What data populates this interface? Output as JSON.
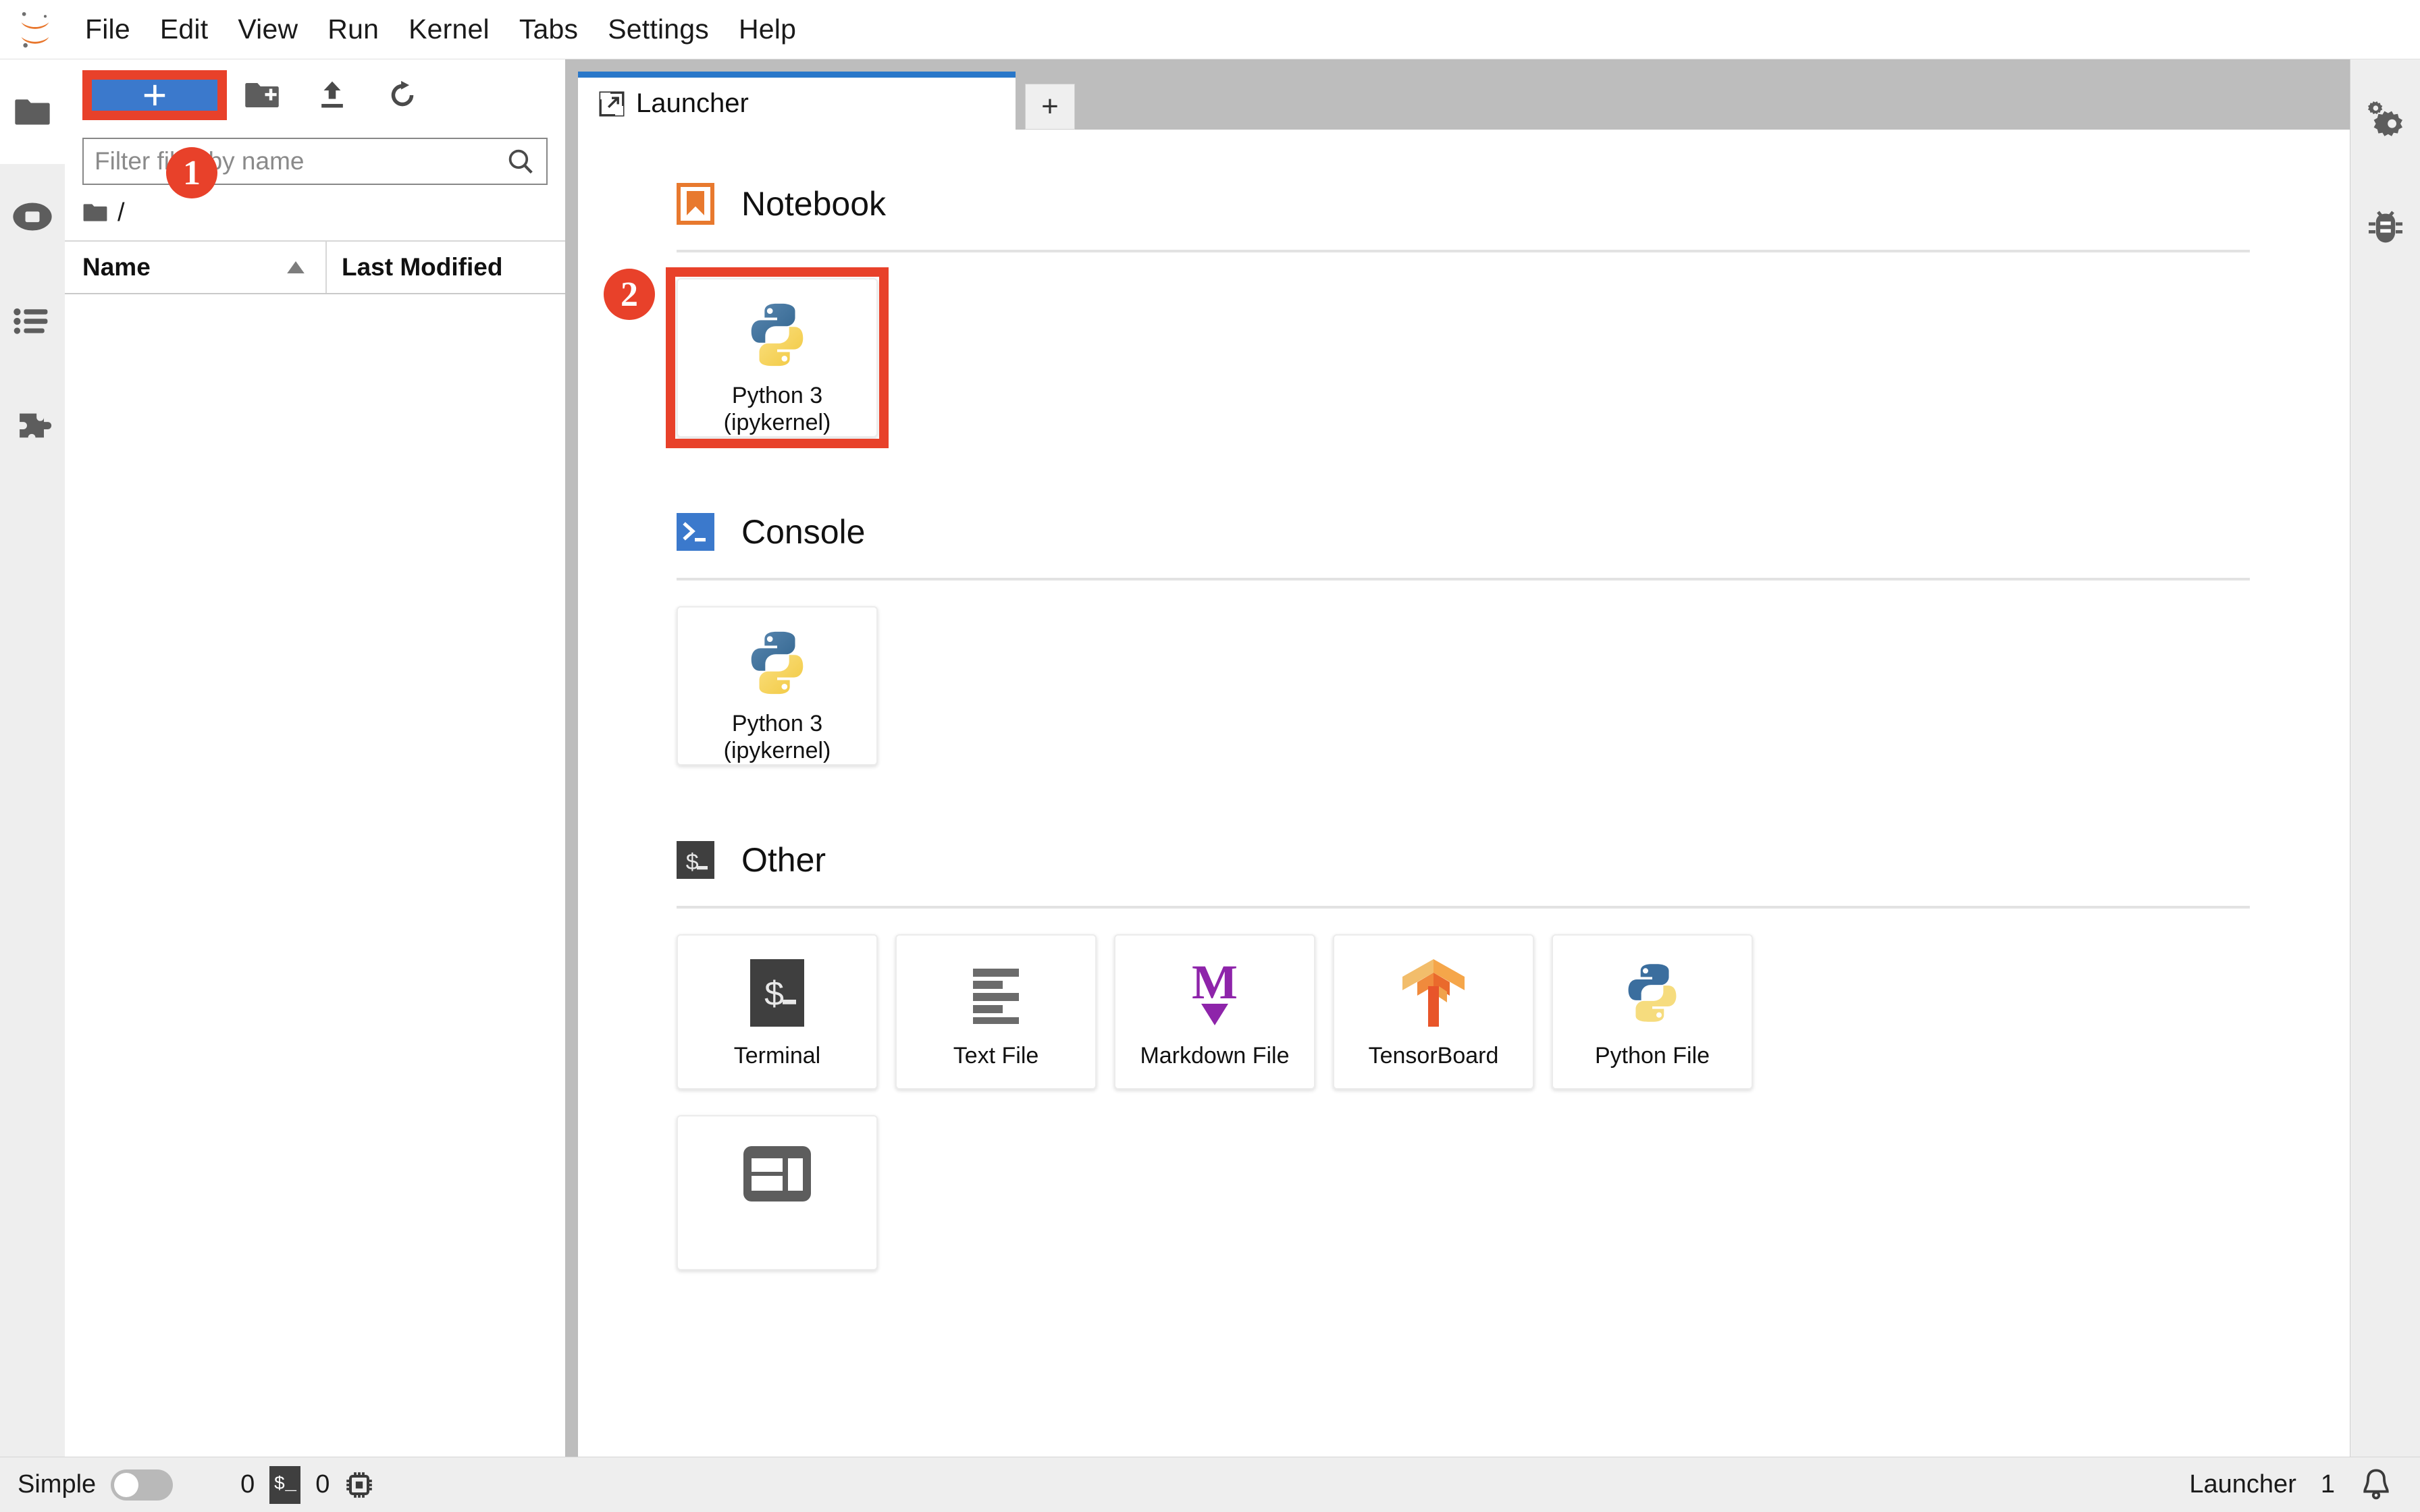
{
  "app": {
    "title": "JupyterLab",
    "logo_icon": "jupyter-logo-icon"
  },
  "menubar": {
    "items": [
      {
        "label": "File",
        "name": "menu-file"
      },
      {
        "label": "Edit",
        "name": "menu-edit"
      },
      {
        "label": "View",
        "name": "menu-view"
      },
      {
        "label": "Run",
        "name": "menu-run"
      },
      {
        "label": "Kernel",
        "name": "menu-kernel"
      },
      {
        "label": "Tabs",
        "name": "menu-tabs"
      },
      {
        "label": "Settings",
        "name": "menu-settings"
      },
      {
        "label": "Help",
        "name": "menu-help"
      }
    ]
  },
  "left_rail": {
    "items": [
      {
        "icon": "folder-icon",
        "label": "File Browser",
        "active": true
      },
      {
        "icon": "running-terminals-icon",
        "label": "Running Terminals and Kernels",
        "active": false
      },
      {
        "icon": "table-of-contents-icon",
        "label": "Table of Contents",
        "active": false
      },
      {
        "icon": "extension-manager-icon",
        "label": "Extension Manager",
        "active": false
      }
    ]
  },
  "right_rail": {
    "items": [
      {
        "icon": "property-inspector-icon",
        "label": "Property Inspector"
      },
      {
        "icon": "debugger-bug-icon",
        "label": "Debugger"
      }
    ]
  },
  "file_browser": {
    "new_launcher_button": {
      "label": "+",
      "name": "new-launcher-button"
    },
    "toolbar_icons": [
      {
        "icon": "new-folder-icon",
        "label": "New Folder"
      },
      {
        "icon": "upload-icon",
        "label": "Upload Files"
      },
      {
        "icon": "refresh-icon",
        "label": "Refresh File List"
      }
    ],
    "filter": {
      "placeholder": "Filter files by name",
      "value": "",
      "icon": "search-icon"
    },
    "breadcrumb": {
      "root_icon": "folder-icon",
      "path": "/"
    },
    "columns": [
      {
        "label": "Name",
        "sort_icon": "sort-ascending-icon"
      },
      {
        "label": "Last Modified"
      }
    ],
    "rows": []
  },
  "main": {
    "tabs": [
      {
        "label": "Launcher",
        "icon": "launcher-icon",
        "active": true
      }
    ],
    "add_tab_button": {
      "label": "+",
      "name": "add-tab-button"
    }
  },
  "launcher": {
    "sections": [
      {
        "name": "notebook",
        "title": "Notebook",
        "icon": "notebook-bookmark-icon",
        "cards": [
          {
            "name": "python3-notebook-card",
            "icon": "python-logo-icon",
            "label_line1": "Python 3",
            "label_line2": "(ipykernel)",
            "highlighted": true
          }
        ]
      },
      {
        "name": "console",
        "title": "Console",
        "icon": "console-prompt-icon",
        "cards": [
          {
            "name": "python3-console-card",
            "icon": "python-logo-icon",
            "label_line1": "Python 3",
            "label_line2": "(ipykernel)",
            "highlighted": false
          }
        ]
      },
      {
        "name": "other",
        "title": "Other",
        "icon": "terminal-dollar-icon",
        "cards": [
          {
            "name": "terminal-card",
            "icon": "terminal-dollar-icon",
            "label_line1": "Terminal",
            "label_line2": "",
            "highlighted": false
          },
          {
            "name": "text-file-card",
            "icon": "text-lines-icon",
            "label_line1": "Text File",
            "label_line2": "",
            "highlighted": false
          },
          {
            "name": "markdown-file-card",
            "icon": "markdown-m-icon",
            "label_line1": "Markdown File",
            "label_line2": "",
            "highlighted": false
          },
          {
            "name": "tensorboard-card",
            "icon": "tensorboard-icon",
            "label_line1": "TensorBoard",
            "label_line2": "",
            "highlighted": false
          },
          {
            "name": "python-file-card",
            "icon": "python-logo-icon",
            "label_line1": "Python File",
            "label_line2": "",
            "highlighted": false
          }
        ],
        "overflow_cards": [
          {
            "name": "contextual-help-card",
            "icon": "layout-panels-icon",
            "label_line1": "",
            "label_line2": "",
            "highlighted": false
          }
        ]
      }
    ]
  },
  "annotations": [
    {
      "id": "badge-1",
      "label": "1",
      "target": "new-launcher-button",
      "color": "#e8412a"
    },
    {
      "id": "badge-2",
      "label": "2",
      "target": "python3-notebook-card",
      "color": "#e8412a"
    }
  ],
  "statusbar": {
    "simple_label": "Simple",
    "simple_toggle_on": false,
    "kernel_count": "0",
    "terminal_icon": "terminal-dollar-icon",
    "terminal_count": "0",
    "cpu_icon": "cpu-chip-icon",
    "active_tab_label": "Launcher",
    "notification_count": "1",
    "notification_icon": "bell-icon"
  },
  "colors": {
    "accent_blue": "#3b79cc",
    "tab_active_border": "#2977c9",
    "annotation_red": "#e8412a",
    "notebook_orange": "#e8792e",
    "console_blue": "#3b79cc",
    "other_dark": "#3f3f3f",
    "markdown_purple": "#8e24aa",
    "tensorboard_orange": "#f0842a",
    "python_blue": "#3b6e9e",
    "python_yellow": "#f6dc7e"
  }
}
